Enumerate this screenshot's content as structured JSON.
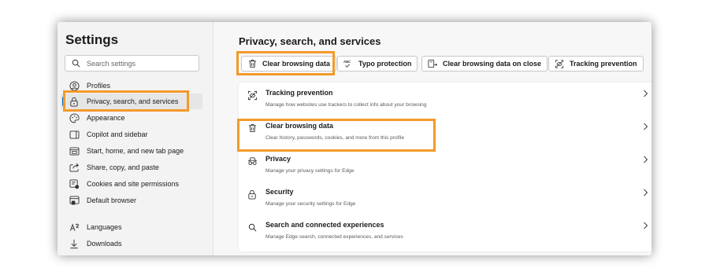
{
  "sidebar": {
    "title": "Settings",
    "search_placeholder": "Search settings",
    "items": [
      {
        "label": "Profiles",
        "icon": "profile-icon"
      },
      {
        "label": "Privacy, search, and services",
        "icon": "lock-icon",
        "active": true
      },
      {
        "label": "Appearance",
        "icon": "appearance-icon"
      },
      {
        "label": "Copilot and sidebar",
        "icon": "sidebar-icon"
      },
      {
        "label": "Start, home, and new tab page",
        "icon": "home-icon"
      },
      {
        "label": "Share, copy, and paste",
        "icon": "share-icon"
      },
      {
        "label": "Cookies and site permissions",
        "icon": "cookies-icon"
      },
      {
        "label": "Default browser",
        "icon": "browser-icon"
      },
      {
        "label": "Languages",
        "icon": "languages-icon"
      },
      {
        "label": "Downloads",
        "icon": "download-icon"
      }
    ]
  },
  "main": {
    "title": "Privacy, search, and services",
    "chips": [
      {
        "label": "Clear browsing data",
        "icon": "trash-icon"
      },
      {
        "label": "Typo protection",
        "icon": "spellcheck-icon"
      },
      {
        "label": "Clear browsing data on close",
        "icon": "clear-on-close-icon"
      },
      {
        "label": "Tracking prevention",
        "icon": "tracking-icon"
      }
    ],
    "rows": [
      {
        "title": "Tracking prevention",
        "desc": "Manage how websites use trackers to collect info about your browsing",
        "icon": "tracking-icon"
      },
      {
        "title": "Clear browsing data",
        "desc": "Clear history, passwords, cookies, and more from this profile",
        "icon": "trash-icon"
      },
      {
        "title": "Privacy",
        "desc": "Manage your privacy settings for Edge",
        "icon": "privacy-icon"
      },
      {
        "title": "Security",
        "desc": "Manage your security settings for Edge",
        "icon": "lock-icon"
      },
      {
        "title": "Search and connected experiences",
        "desc": "Manage Edge search, connected experiences, and services",
        "icon": "search-icon"
      }
    ]
  },
  "colors": {
    "highlight": "#f39a2a",
    "accent": "#0067c0"
  }
}
